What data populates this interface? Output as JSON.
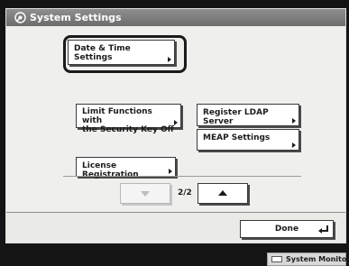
{
  "window": {
    "title": "System Settings",
    "icon": "wrench-gear-icon"
  },
  "buttons": {
    "date_time": "Date & Time Settings",
    "limit_functions": "Limit Functions with\nthe Security Key Off",
    "register_ldap": "Register LDAP Server",
    "meap_settings": "MEAP Settings",
    "license_registration": "License Registration"
  },
  "pagination": {
    "current": "2/2",
    "prev_icon": "triangle-down-icon",
    "next_icon": "triangle-up-icon",
    "down_enabled": false,
    "up_enabled": true
  },
  "footer": {
    "done_label": "Done",
    "done_icon": "enter-arrow-icon",
    "system_monitor_label": "System Monitor"
  },
  "colors": {
    "title_bar": "#7b7b7b",
    "panel_background": "#eff0ed",
    "frame": "#141414"
  }
}
